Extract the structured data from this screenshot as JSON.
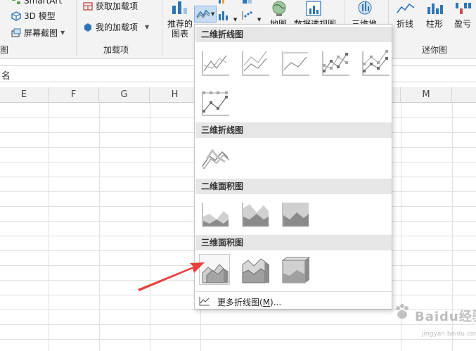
{
  "ribbon": {
    "smartart_label": "SmartArt",
    "model3d_label": "3D 模型",
    "screenshot_label": "屏幕截图",
    "left_group_tail": "图",
    "get_addins_label": "获取加载项",
    "my_addins_label": "我的加载项",
    "addins_group_label": "加载项",
    "recommended_label_line1": "推荐的",
    "recommended_label_line2": "图表",
    "map_label": "地图",
    "pivotchart_label": "数据透视图",
    "map3d_label": "三维地",
    "sparkline_line_label": "折线",
    "sparkline_column_label": "柱形",
    "sparkline_winloss_label": "盈亏",
    "sparklines_group_label": "迷你图"
  },
  "formula_bar": {
    "name_box_text": "名"
  },
  "grid": {
    "columns": [
      "E",
      "F",
      "G",
      "H",
      "M"
    ]
  },
  "menu": {
    "sections": {
      "line2d": "二维折线图",
      "line3d": "三维折线图",
      "area2d": "二维面积图",
      "area3d": "三维面积图"
    },
    "more_label_prefix": "更多折线图(",
    "more_label_key": "M",
    "more_label_suffix": ")..."
  },
  "watermark": {
    "text": "Baidu经验",
    "sub": "jingyan.baidu.com"
  },
  "colors": {
    "arrow": "#e8413c",
    "menu_section_bg": "#e6e6e6",
    "ribbon_bg": "#f3f3f3"
  }
}
